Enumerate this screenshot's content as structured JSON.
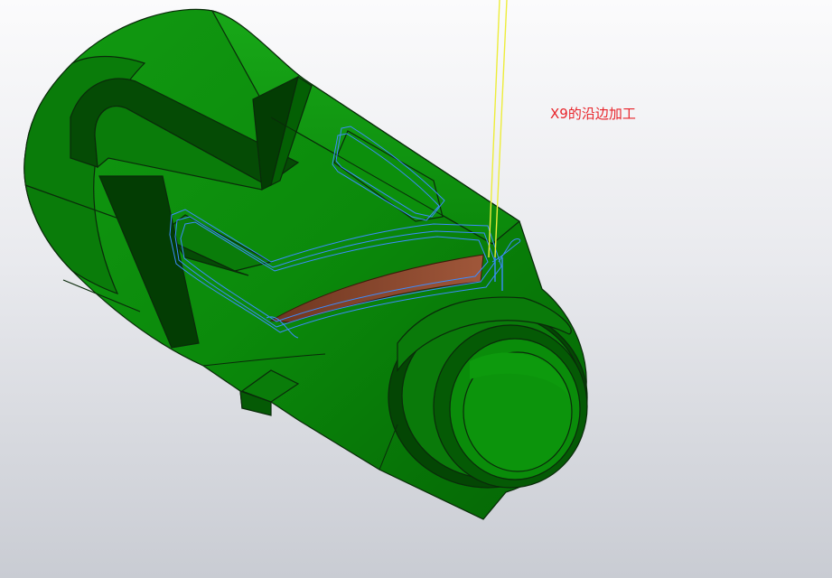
{
  "viewport": {
    "annotation_text": "X9的沿边加工",
    "annotation_color": "#e8242a",
    "background_top": "#fbfbfc",
    "background_bottom": "#c9ccd3"
  },
  "model": {
    "part_color": "#0b8a0b",
    "part_dark": "#055a05",
    "edge_color": "#0a2a0a",
    "machined_face_color": "#8b4a2e",
    "toolpath_color": "#3c8cff",
    "tool_axis_color": "#eded3a"
  }
}
